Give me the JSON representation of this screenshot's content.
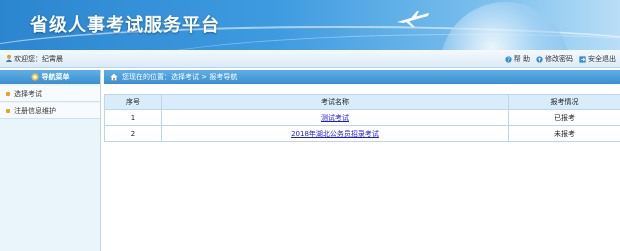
{
  "header": {
    "title": "省级人事考试服务平台"
  },
  "topbar": {
    "welcome": "欢迎您：纪霄晨",
    "links": [
      {
        "label": "帮 助",
        "icon": "help-icon"
      },
      {
        "label": "修改密码",
        "icon": "key-icon"
      },
      {
        "label": "安全退出",
        "icon": "logout-icon"
      }
    ]
  },
  "sidebar": {
    "title": "导航菜单",
    "items": [
      {
        "label": "选择考试"
      },
      {
        "label": "注册信息维护"
      }
    ]
  },
  "breadcrumb": {
    "text": "您现在的位置：选择考试 > 报考导航"
  },
  "table": {
    "headers": [
      "序号",
      "考试名称",
      "报考情况"
    ],
    "rows": [
      {
        "no": "1",
        "name": "测试考试",
        "status": "已报考"
      },
      {
        "no": "2",
        "name": "2018年湖北公务员招录考试",
        "status": "未报考"
      }
    ]
  },
  "colors": {
    "accent": "#3a8fd0",
    "header": "#2b86cf",
    "link": "#1a1ae0",
    "bullet": "#f0a020"
  }
}
